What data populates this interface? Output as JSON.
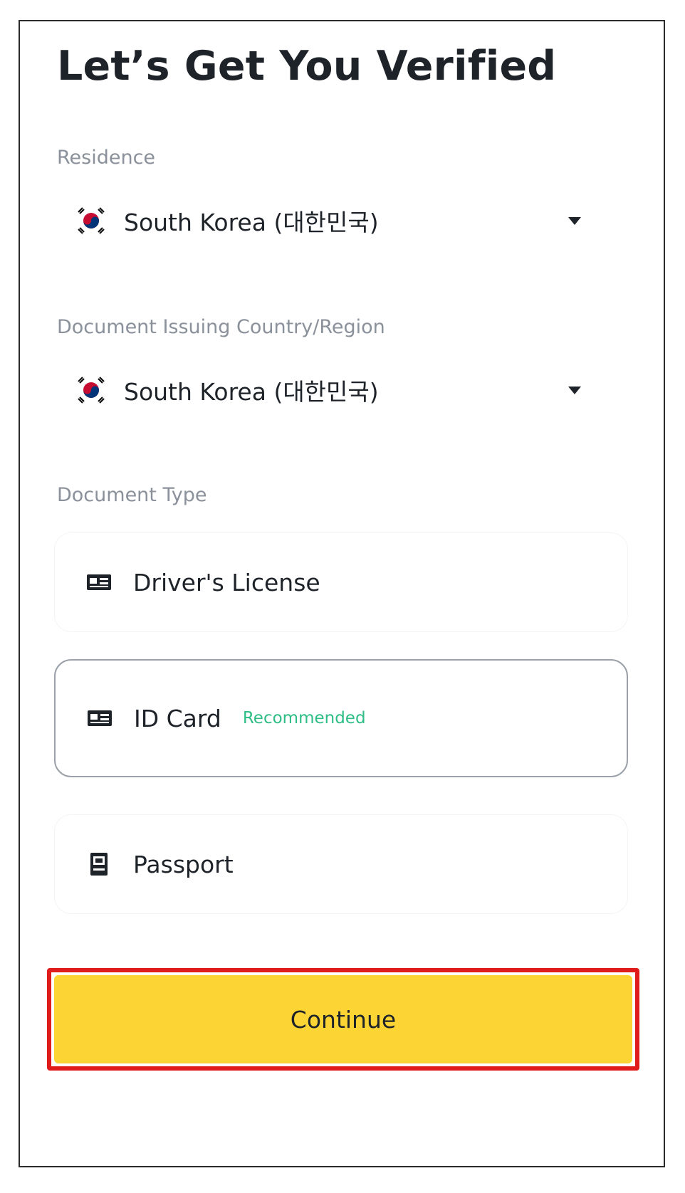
{
  "page": {
    "title": "Let’s Get You Verified"
  },
  "residence": {
    "label": "Residence",
    "value": "South Korea (대한민국)",
    "flag_icon": "south-korea-flag-icon"
  },
  "issuing_country": {
    "label": "Document Issuing Country/Region",
    "value": "South Korea (대한민국)",
    "flag_icon": "south-korea-flag-icon"
  },
  "document_type": {
    "label": "Document Type",
    "selected": "ID Card",
    "options": [
      {
        "label": "Driver's License",
        "icon": "id-card-icon",
        "badge": ""
      },
      {
        "label": "ID Card",
        "icon": "id-card-icon",
        "badge": "Recommended"
      },
      {
        "label": "Passport",
        "icon": "passport-icon",
        "badge": ""
      }
    ]
  },
  "actions": {
    "continue_label": "Continue"
  },
  "colors": {
    "accent": "#fcd535",
    "highlight_border": "#e01b1b",
    "badge": "#2ebd85",
    "text": "#1e2329",
    "label": "#8a919a"
  }
}
